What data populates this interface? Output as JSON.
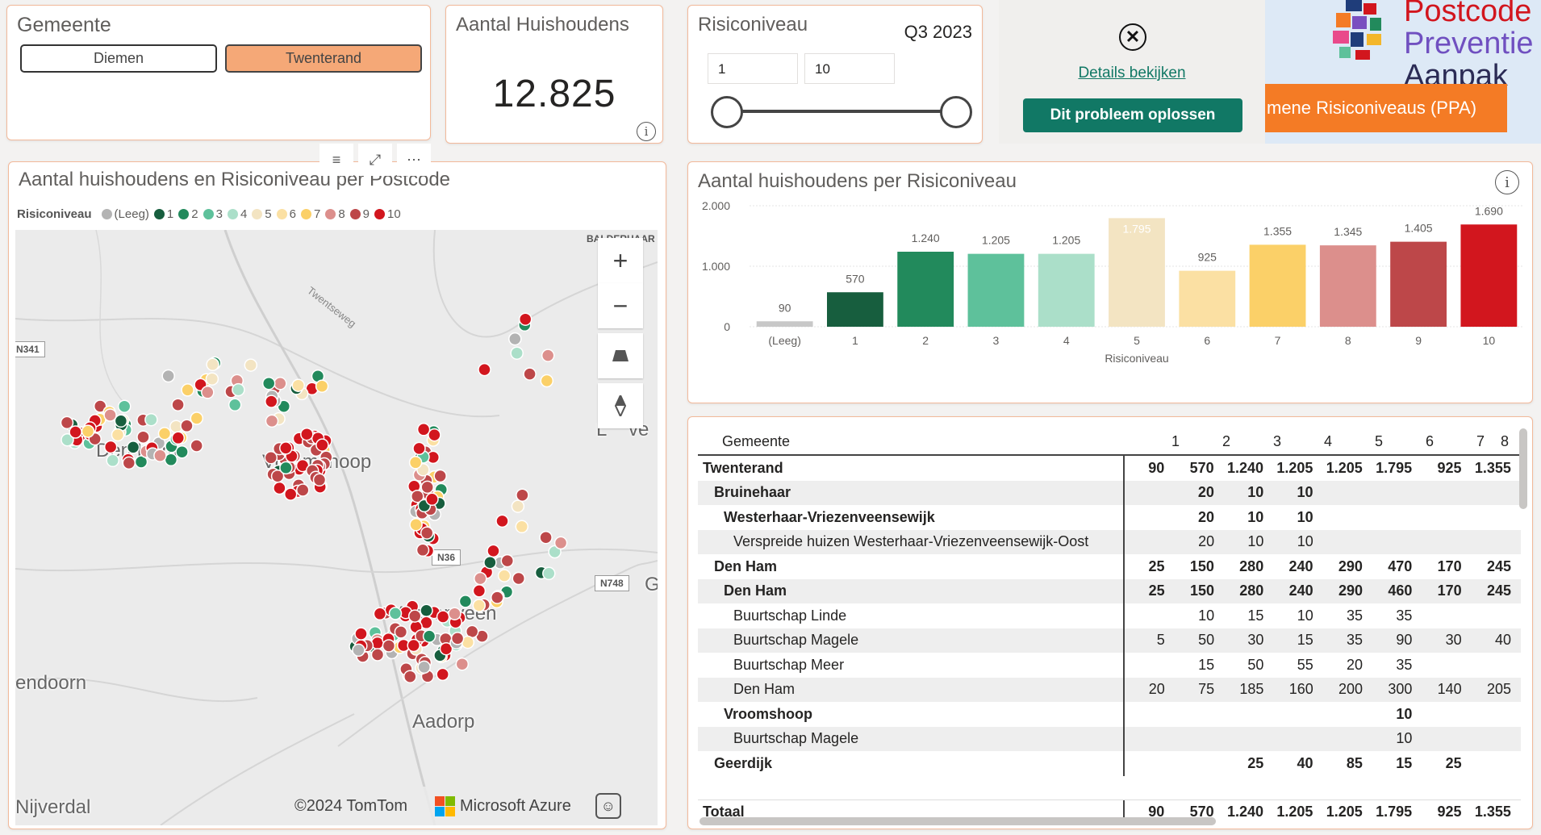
{
  "gemeente_slicer": {
    "title": "Gemeente",
    "options": [
      {
        "label": "Diemen",
        "selected": false
      },
      {
        "label": "Twenterand",
        "selected": true
      }
    ]
  },
  "kpi": {
    "title": "Aantal Huishoudens",
    "value": "12.825",
    "info_icon": "i"
  },
  "risico_slider": {
    "title": "Risiconiveau",
    "period": "Q3 2023",
    "min_value": "1",
    "max_value": "10"
  },
  "error_overlay": {
    "close_icon": "✕",
    "details_link": "Details bekijken",
    "fix_button": "Dit probleem oplossen"
  },
  "logo": {
    "line1": "Postcode",
    "line2": "Preventie",
    "line3": "Aanpak",
    "banner": "mene Risiconiveaus (PPA)"
  },
  "map": {
    "title": "Aantal huishoudens en Risiconiveau per Postcode",
    "toolbar": {
      "filter_icon": "≡",
      "focus_icon": "⤢",
      "more_icon": "⋯"
    },
    "legend": {
      "title": "Risiconiveau",
      "items": [
        {
          "label": "(Leeg)",
          "color": "#b3b3b3"
        },
        {
          "label": "1",
          "color": "#175e3e"
        },
        {
          "label": "2",
          "color": "#228a5c"
        },
        {
          "label": "3",
          "color": "#5ec19b"
        },
        {
          "label": "4",
          "color": "#abdfc9"
        },
        {
          "label": "5",
          "color": "#f3e4c2"
        },
        {
          "label": "6",
          "color": "#fbe0a3"
        },
        {
          "label": "7",
          "color": "#fbd068"
        },
        {
          "label": "8",
          "color": "#dc8f8c"
        },
        {
          "label": "9",
          "color": "#bd4749"
        },
        {
          "label": "10",
          "color": "#d2161e"
        }
      ]
    },
    "places": [
      {
        "label": "Den Ham"
      },
      {
        "label": "Vroomshoop"
      },
      {
        "label": "Vriezenveen"
      },
      {
        "label": "Aadorp"
      },
      {
        "label": "endoorn"
      },
      {
        "label": "Nijverdal"
      },
      {
        "label": "L"
      },
      {
        "label": "ve"
      },
      {
        "label": "G"
      }
    ],
    "roads": [
      {
        "label": "BALDERHAAR"
      },
      {
        "label": "N341"
      },
      {
        "label": "N36"
      },
      {
        "label": "N748"
      },
      {
        "label": "Twentseweg"
      }
    ],
    "controls": {
      "zoom_in": "+",
      "zoom_out": "−"
    },
    "attribution": {
      "copyright": "©2024 TomTom",
      "provider": "Microsoft Azure"
    }
  },
  "bar_chart": {
    "title": "Aantal huishoudens per Risiconiveau",
    "info_icon": "i"
  },
  "chart_data": {
    "type": "bar",
    "title": "Aantal huishoudens per Risiconiveau",
    "xlabel": "Risiconiveau",
    "ylabel": "",
    "categories": [
      "(Leeg)",
      "1",
      "2",
      "3",
      "4",
      "5",
      "6",
      "7",
      "8",
      "9",
      "10"
    ],
    "values": [
      90,
      570,
      1240,
      1205,
      1205,
      1795,
      925,
      1355,
      1345,
      1405,
      1690
    ],
    "value_labels": [
      "90",
      "570",
      "1.240",
      "1.205",
      "1.205",
      "1.795",
      "925",
      "1.355",
      "1.345",
      "1.405",
      "1.690"
    ],
    "colors": [
      "#c8c8c8",
      "#175e3e",
      "#228a5c",
      "#5ec19b",
      "#abdfc9",
      "#f3e4c2",
      "#fbe0a3",
      "#fbd068",
      "#dc8f8c",
      "#bd4749",
      "#d2161e"
    ],
    "yticks": [
      "0",
      "1.000",
      "2.000"
    ],
    "ylim": [
      0,
      2000
    ],
    "grid": true
  },
  "table": {
    "header": {
      "name": "Gemeente",
      "cols": [
        "1",
        "2",
        "3",
        "4",
        "5",
        "6",
        "7",
        "8"
      ]
    },
    "rows": [
      {
        "name": "Twenterand",
        "level": 0,
        "bold": true,
        "cells": [
          "90",
          "570",
          "1.240",
          "1.205",
          "1.205",
          "1.795",
          "925",
          "1.355"
        ]
      },
      {
        "name": "Bruinehaar",
        "level": 1,
        "bold": true,
        "cells": [
          "",
          "20",
          "10",
          "10",
          "",
          "",
          "",
          ""
        ]
      },
      {
        "name": "Westerhaar-Vriezenveensewijk",
        "level": 2,
        "bold": true,
        "cells": [
          "",
          "20",
          "10",
          "10",
          "",
          "",
          "",
          ""
        ]
      },
      {
        "name": "Verspreide huizen Westerhaar-Vriezenveensewijk-Oost",
        "level": 3,
        "bold": false,
        "cells": [
          "",
          "20",
          "10",
          "10",
          "",
          "",
          "",
          ""
        ]
      },
      {
        "name": "Den Ham",
        "level": 1,
        "bold": true,
        "cells": [
          "25",
          "150",
          "280",
          "240",
          "290",
          "470",
          "170",
          "245"
        ]
      },
      {
        "name": "Den Ham",
        "level": 2,
        "bold": true,
        "cells": [
          "25",
          "150",
          "280",
          "240",
          "290",
          "460",
          "170",
          "245"
        ]
      },
      {
        "name": "Buurtschap Linde",
        "level": 3,
        "bold": false,
        "cells": [
          "",
          "10",
          "15",
          "10",
          "35",
          "35",
          "",
          ""
        ]
      },
      {
        "name": "Buurtschap Magele",
        "level": 3,
        "bold": false,
        "cells": [
          "5",
          "50",
          "30",
          "15",
          "35",
          "90",
          "30",
          "40"
        ]
      },
      {
        "name": "Buurtschap Meer",
        "level": 3,
        "bold": false,
        "cells": [
          "",
          "15",
          "50",
          "55",
          "20",
          "35",
          "",
          ""
        ]
      },
      {
        "name": "Den Ham",
        "level": 3,
        "bold": false,
        "cells": [
          "20",
          "75",
          "185",
          "160",
          "200",
          "300",
          "140",
          "205"
        ]
      },
      {
        "name": "Vroomshoop",
        "level": 2,
        "bold": true,
        "cells": [
          "",
          "",
          "",
          "",
          "",
          "10",
          "",
          ""
        ]
      },
      {
        "name": "Buurtschap Magele",
        "level": 3,
        "bold": false,
        "cells": [
          "",
          "",
          "",
          "",
          "",
          "10",
          "",
          ""
        ]
      },
      {
        "name": "Geerdijk",
        "level": 1,
        "bold": true,
        "cells": [
          "",
          "",
          "25",
          "40",
          "85",
          "15",
          "25",
          ""
        ]
      }
    ],
    "total": {
      "name": "Totaal",
      "cells": [
        "90",
        "570",
        "1.240",
        "1.205",
        "1.205",
        "1.795",
        "925",
        "1.355"
      ]
    }
  }
}
